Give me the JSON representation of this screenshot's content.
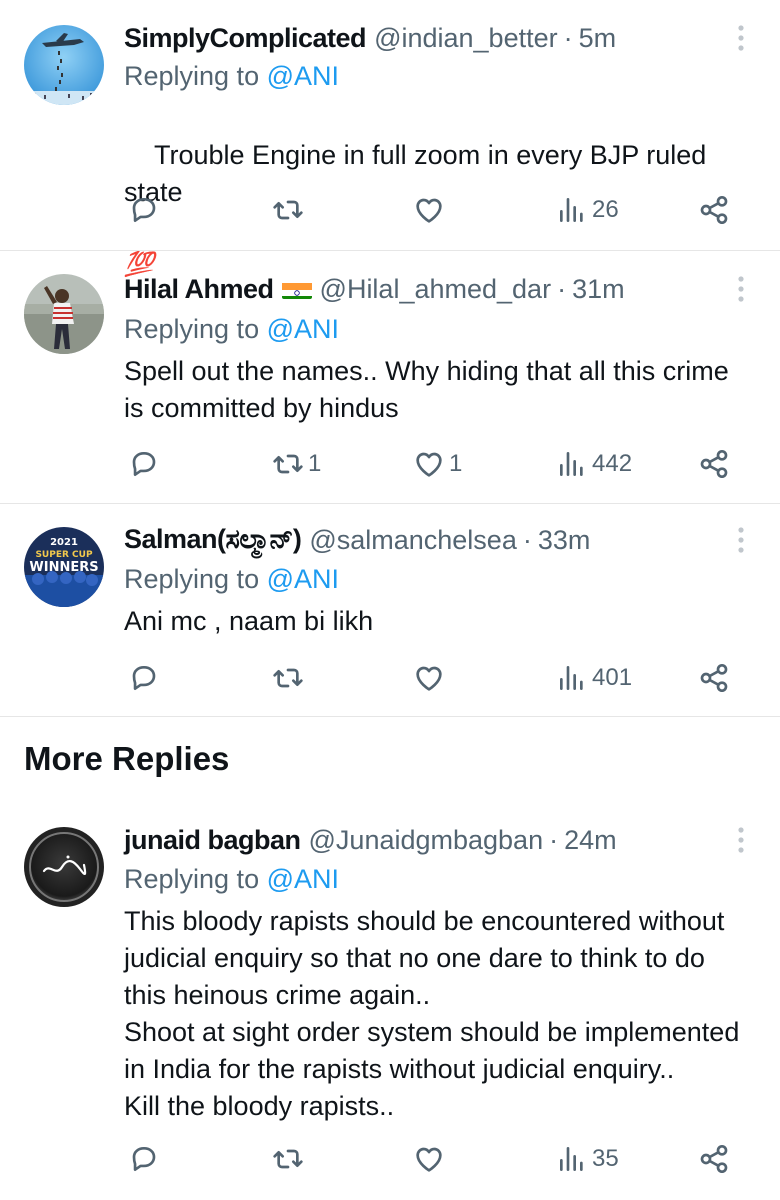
{
  "replies": [
    {
      "name": "SimplyComplicated",
      "handle": "@indian_better",
      "dot": "·",
      "time": "5m",
      "replying_prefix": "Replying to ",
      "replying_to": "@ANI",
      "text": "Trouble Engine in full zoom in every BJP ruled state",
      "emoji": "💯",
      "reply_count": "",
      "retweet_count": "",
      "like_count": "",
      "view_count": "26"
    },
    {
      "name": "Hilal Ahmed",
      "flag": "india-flag-icon",
      "handle": "@Hilal_ahmed_dar",
      "dot": "·",
      "time": "31m",
      "replying_prefix": "Replying to ",
      "replying_to": "@ANI",
      "text": "Spell out the names.. Why hiding that all this crime\nis committed by hindus",
      "reply_count": "",
      "retweet_count": "1",
      "like_count": "1",
      "view_count": "442"
    },
    {
      "name": "Salman(ಸಲ್ಮಾನ್)",
      "handle": "@salmanchelsea",
      "dot": "·",
      "time": "33m",
      "replying_prefix": "Replying to ",
      "replying_to": "@ANI",
      "text": "Ani mc , naam bi likh",
      "avatar_text": [
        "2021",
        "SUPER CUP",
        "WINNERS"
      ],
      "reply_count": "",
      "retweet_count": "",
      "like_count": "",
      "view_count": "401"
    }
  ],
  "more_replies_title": "More Replies",
  "more": [
    {
      "name": "junaid bagban",
      "handle": "@Junaidgmbagban",
      "dot": "·",
      "time": "24m",
      "replying_prefix": "Replying to ",
      "replying_to": "@ANI",
      "text": "This bloody rapists should be encountered without\njudicial enquiry so that no one dare to think to do\nthis heinous crime again..\nShoot at sight order system should be implemented\nin India for the rapists without judicial enquiry..\nKill the bloody rapists..",
      "reply_count": "",
      "retweet_count": "",
      "like_count": "",
      "view_count": "35"
    }
  ],
  "colors": {
    "text": "#0f1419",
    "secondary": "#536471",
    "accent": "#1d9bf0",
    "divider": "#e6e6e6"
  }
}
